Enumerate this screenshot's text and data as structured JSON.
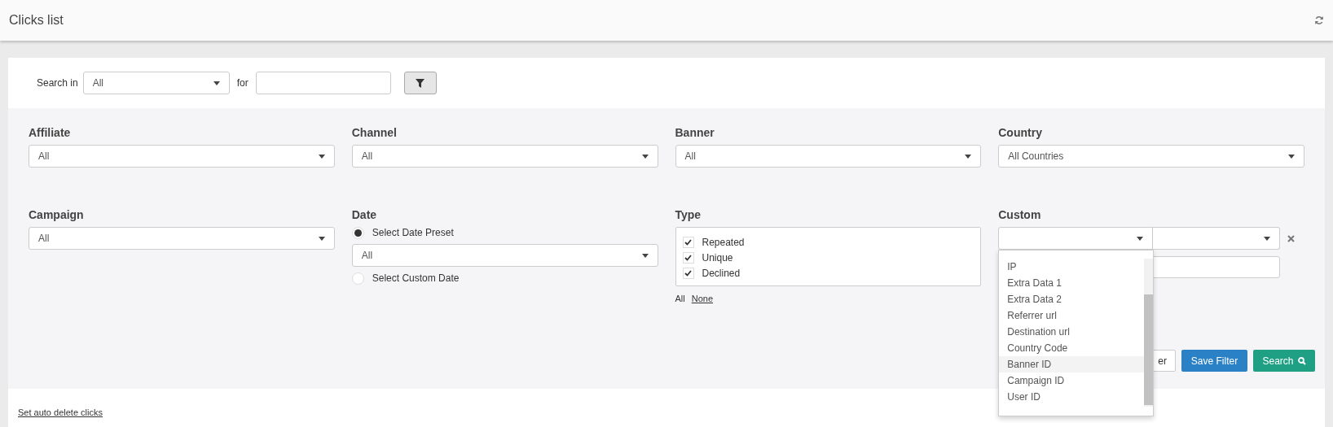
{
  "header": {
    "title": "Clicks list"
  },
  "search": {
    "label": "Search in",
    "scope": "All",
    "for_label": "for"
  },
  "filters": [
    {
      "kind": "select",
      "label": "Affiliate",
      "value": "All"
    },
    {
      "kind": "select",
      "label": "Channel",
      "value": "All"
    },
    {
      "kind": "select",
      "label": "Banner",
      "value": "All"
    },
    {
      "kind": "select",
      "label": "Country",
      "value": "All Countries"
    },
    {
      "kind": "select",
      "label": "Campaign",
      "value": "All"
    },
    {
      "kind": "date",
      "label": "Date",
      "options": [
        {
          "label": "Select Date Preset",
          "selected": true
        },
        {
          "label": "Select Custom Date",
          "selected": false
        }
      ],
      "preset": "All"
    },
    {
      "kind": "checklist",
      "label": "Type",
      "items": [
        {
          "label": "Repeated",
          "checked": true
        },
        {
          "label": "Unique",
          "checked": true
        },
        {
          "label": "Declined",
          "checked": true
        }
      ],
      "links": [
        {
          "label": "All",
          "underlined": false
        },
        {
          "label": "None",
          "underlined": true
        }
      ]
    },
    {
      "kind": "custom",
      "label": "Custom",
      "dropdown": [
        {
          "label": "IP",
          "highlighted": false
        },
        {
          "label": "Extra Data 1",
          "highlighted": false
        },
        {
          "label": "Extra Data 2",
          "highlighted": false
        },
        {
          "label": "Referrer url",
          "highlighted": false
        },
        {
          "label": "Destination url",
          "highlighted": false
        },
        {
          "label": "Country Code",
          "highlighted": false
        },
        {
          "label": "Banner ID",
          "highlighted": true
        },
        {
          "label": "Campaign ID",
          "highlighted": false
        },
        {
          "label": "User ID",
          "highlighted": false
        }
      ]
    }
  ],
  "buttons": [
    {
      "label": "er",
      "kind": "default"
    },
    {
      "label": "Save Filter",
      "kind": "primary"
    },
    {
      "label": "Search",
      "kind": "success"
    }
  ],
  "footer": {
    "link": "Set auto delete clicks"
  }
}
